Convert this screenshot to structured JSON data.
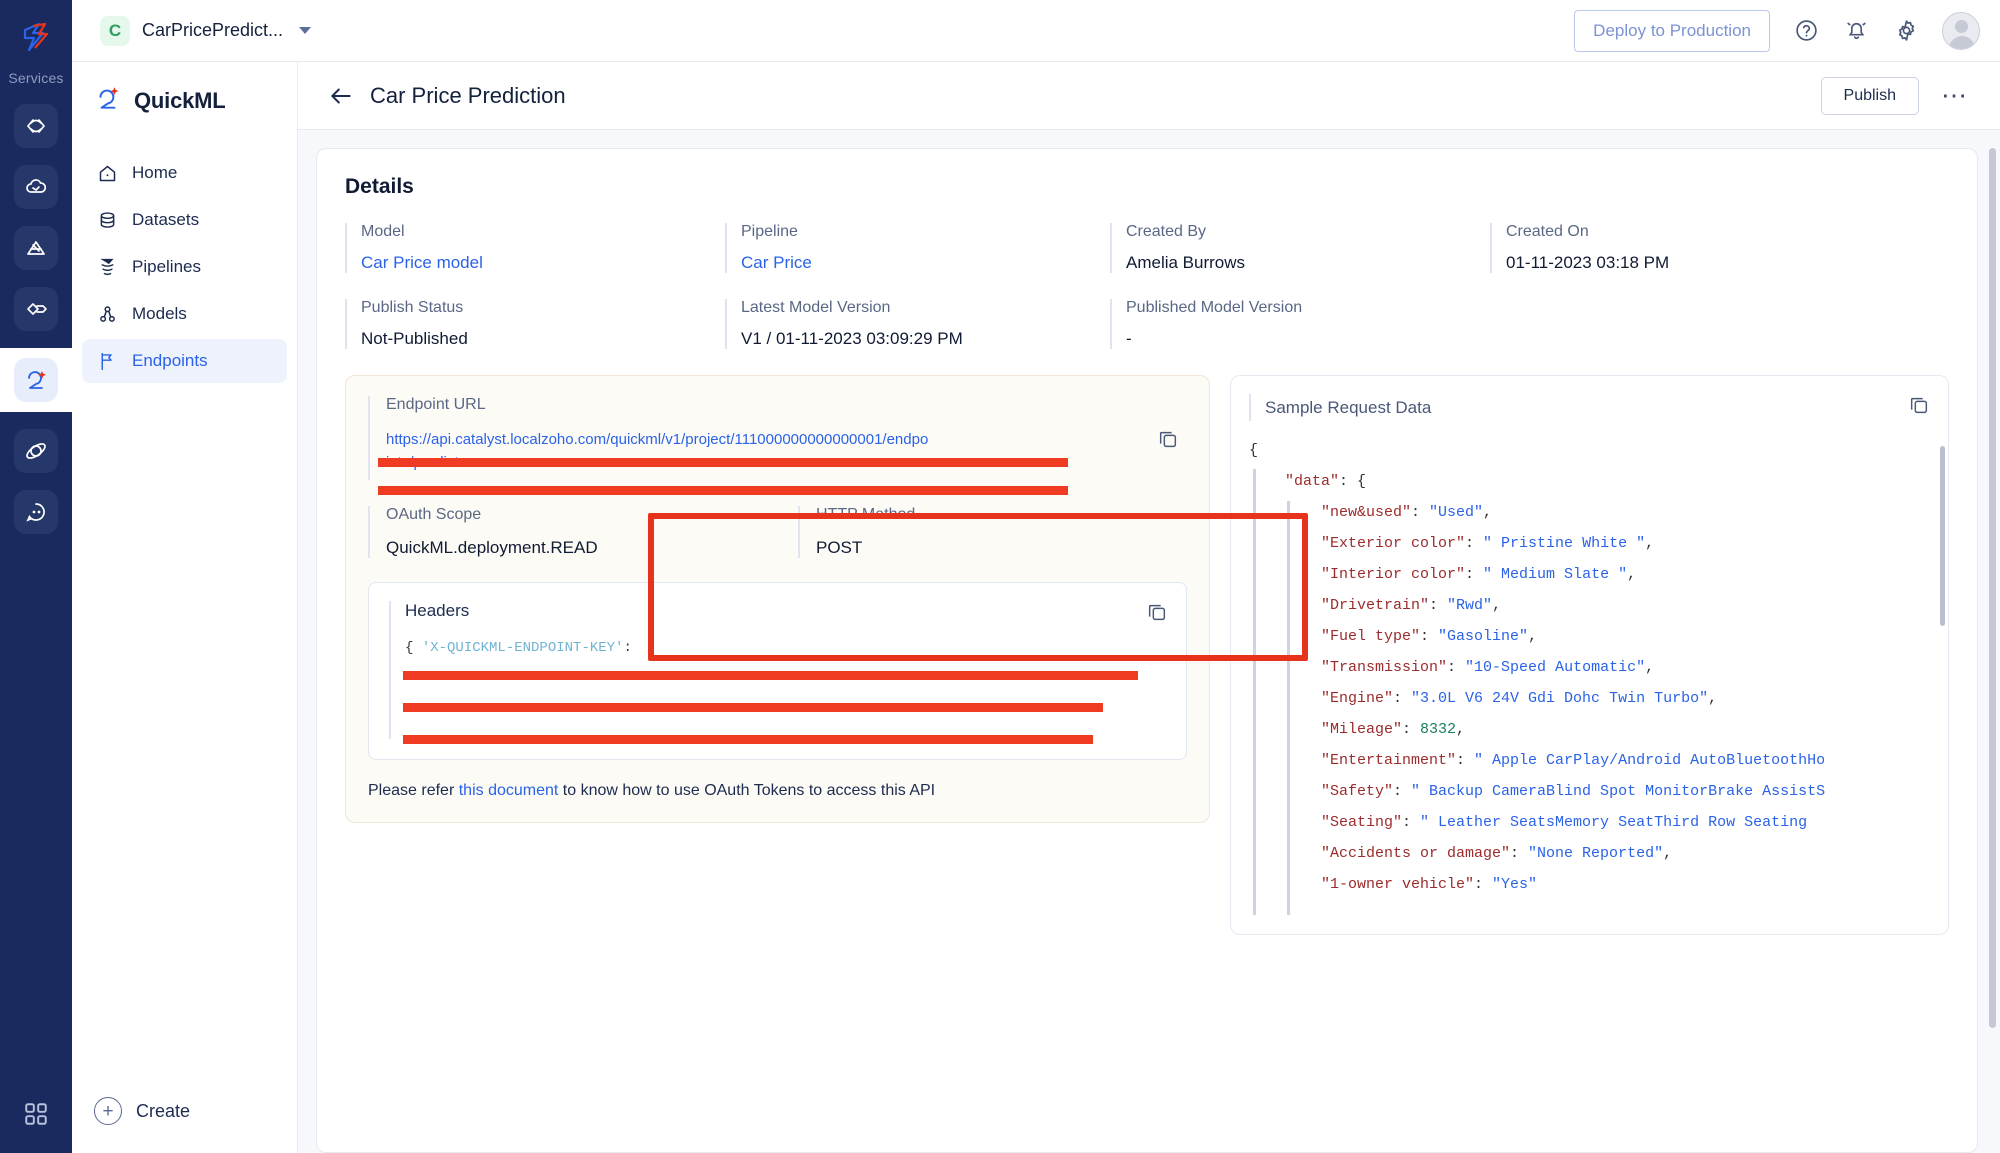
{
  "rail": {
    "services_label": "Services",
    "logo_icon": "brand-logo-icon",
    "items": [
      {
        "icon": "code-service-icon",
        "active": false
      },
      {
        "icon": "cloud-service-icon",
        "active": false
      },
      {
        "icon": "analytics-service-icon",
        "active": false
      },
      {
        "icon": "link-service-icon",
        "active": false
      },
      {
        "icon": "quickml-service-icon",
        "active": true
      },
      {
        "icon": "orbit-service-icon",
        "active": false
      },
      {
        "icon": "chat-service-icon",
        "active": false
      }
    ],
    "bottom_icon": "apps-grid-icon"
  },
  "topbar": {
    "project_initial": "C",
    "project_name": "CarPricePredict...",
    "dropdown_icon": "chevron-down-icon",
    "deploy_label": "Deploy to Production",
    "help_icon": "help-circle-icon",
    "bell_icon": "notification-bell-icon",
    "gear_icon": "settings-gear-icon",
    "avatar_icon": "user-avatar"
  },
  "sidebar": {
    "brand": "QuickML",
    "brand_icon": "quickml-logo-icon",
    "items": [
      {
        "label": "Home",
        "icon": "home-icon",
        "active": false
      },
      {
        "label": "Datasets",
        "icon": "database-icon",
        "active": false
      },
      {
        "label": "Pipelines",
        "icon": "funnel-icon",
        "active": false
      },
      {
        "label": "Models",
        "icon": "models-nodes-icon",
        "active": false
      },
      {
        "label": "Endpoints",
        "icon": "flag-icon",
        "active": true
      }
    ],
    "create_label": "Create",
    "create_icon": "plus-circle-icon"
  },
  "page": {
    "back_icon": "arrow-left-icon",
    "title": "Car Price Prediction",
    "publish_label": "Publish",
    "more_icon": "ellipsis-icon"
  },
  "details": {
    "heading": "Details",
    "row1": [
      {
        "label": "Model",
        "value": "Car Price model",
        "link": true
      },
      {
        "label": "Pipeline",
        "value": "Car Price",
        "link": true
      },
      {
        "label": "Created By",
        "value": "Amelia Burrows",
        "link": false
      },
      {
        "label": "Created On",
        "value": "01-11-2023 03:18 PM",
        "link": false
      }
    ],
    "row2": [
      {
        "label": "Publish Status",
        "value": "Not-Published",
        "link": false
      },
      {
        "label": "Latest Model Version",
        "value": "V1 / 01-11-2023 03:09:29 PM",
        "link": false
      },
      {
        "label": "Published Model Version",
        "value": "-",
        "link": false
      }
    ]
  },
  "endpoint": {
    "url_label": "Endpoint URL",
    "url_value": "https://api.catalyst.localzoho.com/quickml/v1/project/111000000000000001/endpoints/predict",
    "copy_icon": "copy-icon",
    "oauth_label": "OAuth Scope",
    "oauth_value": "QuickML.deployment.READ",
    "method_label": "HTTP Method",
    "method_value": "POST"
  },
  "headers": {
    "title": "Headers",
    "copy_icon": "copy-icon",
    "open_brace": "{",
    "key_name": "'X-QUICKML-ENDPOINT-KEY'",
    "colon": ":",
    "redacted_line1": "",
    "redacted_line2": "",
    "redacted_line3": ""
  },
  "footer": {
    "prefix": "Please refer ",
    "link": "this document",
    "suffix": " to know how to use OAuth Tokens to access this API"
  },
  "sample": {
    "title": "Sample Request Data",
    "copy_icon": "copy-icon",
    "lines": [
      {
        "indent": 0,
        "parts": [
          {
            "t": "{",
            "c": "jp"
          }
        ]
      },
      {
        "indent": 1,
        "parts": [
          {
            "t": "\"data\"",
            "c": "jk"
          },
          {
            "t": ": {",
            "c": "jp"
          }
        ]
      },
      {
        "indent": 2,
        "parts": [
          {
            "t": "\"new&used\"",
            "c": "jk"
          },
          {
            "t": ": ",
            "c": "jp"
          },
          {
            "t": "\"Used\"",
            "c": "jv"
          },
          {
            "t": ",",
            "c": "jp"
          }
        ]
      },
      {
        "indent": 2,
        "parts": [
          {
            "t": "\"Exterior color\"",
            "c": "jk"
          },
          {
            "t": ": ",
            "c": "jp"
          },
          {
            "t": "\" Pristine White \"",
            "c": "jv"
          },
          {
            "t": ",",
            "c": "jp"
          }
        ]
      },
      {
        "indent": 2,
        "parts": [
          {
            "t": "\"Interior color\"",
            "c": "jk"
          },
          {
            "t": ": ",
            "c": "jp"
          },
          {
            "t": "\" Medium Slate \"",
            "c": "jv"
          },
          {
            "t": ",",
            "c": "jp"
          }
        ]
      },
      {
        "indent": 2,
        "parts": [
          {
            "t": "\"Drivetrain\"",
            "c": "jk"
          },
          {
            "t": ": ",
            "c": "jp"
          },
          {
            "t": "\"Rwd\"",
            "c": "jv"
          },
          {
            "t": ",",
            "c": "jp"
          }
        ]
      },
      {
        "indent": 2,
        "parts": [
          {
            "t": "\"Fuel type\"",
            "c": "jk"
          },
          {
            "t": ": ",
            "c": "jp"
          },
          {
            "t": "\"Gasoline\"",
            "c": "jv"
          },
          {
            "t": ",",
            "c": "jp"
          }
        ]
      },
      {
        "indent": 2,
        "parts": [
          {
            "t": "\"Transmission\"",
            "c": "jk"
          },
          {
            "t": ": ",
            "c": "jp"
          },
          {
            "t": "\"10-Speed Automatic\"",
            "c": "jv"
          },
          {
            "t": ",",
            "c": "jp"
          }
        ]
      },
      {
        "indent": 2,
        "parts": [
          {
            "t": "\"Engine\"",
            "c": "jk"
          },
          {
            "t": ": ",
            "c": "jp"
          },
          {
            "t": "\"3.0L V6 24V Gdi Dohc Twin Turbo\"",
            "c": "jv"
          },
          {
            "t": ",",
            "c": "jp"
          }
        ]
      },
      {
        "indent": 2,
        "parts": [
          {
            "t": "\"Mileage\"",
            "c": "jk"
          },
          {
            "t": ": ",
            "c": "jp"
          },
          {
            "t": "8332",
            "c": "jn"
          },
          {
            "t": ",",
            "c": "jp"
          }
        ]
      },
      {
        "indent": 2,
        "parts": [
          {
            "t": "\"Entertainment\"",
            "c": "jk"
          },
          {
            "t": ": ",
            "c": "jp"
          },
          {
            "t": "\"  Apple CarPlay/Android AutoBluetoothHo",
            "c": "jv"
          }
        ]
      },
      {
        "indent": 2,
        "parts": [
          {
            "t": "\"Safety\"",
            "c": "jk"
          },
          {
            "t": ": ",
            "c": "jp"
          },
          {
            "t": "\"  Backup CameraBlind Spot MonitorBrake AssistS",
            "c": "jv"
          }
        ]
      },
      {
        "indent": 2,
        "parts": [
          {
            "t": "\"Seating\"",
            "c": "jk"
          },
          {
            "t": ": ",
            "c": "jp"
          },
          {
            "t": "\"  Leather SeatsMemory SeatThird Row Seating",
            "c": "jv"
          }
        ]
      },
      {
        "indent": 2,
        "parts": [
          {
            "t": "\"Accidents or damage\"",
            "c": "jk"
          },
          {
            "t": ": ",
            "c": "jp"
          },
          {
            "t": "\"None Reported\"",
            "c": "jv"
          },
          {
            "t": ",",
            "c": "jp"
          }
        ]
      },
      {
        "indent": 2,
        "parts": [
          {
            "t": "\"1-owner vehicle\"",
            "c": "jk"
          },
          {
            "t": ": ",
            "c": "jp"
          },
          {
            "t": "\"Yes\"",
            "c": "jv"
          }
        ]
      }
    ]
  },
  "colors": {
    "rail_bg": "#1b2a5e",
    "accent_blue": "#2a62e8",
    "redaction": "#ee3b22",
    "beige_bg": "#fdfbf5"
  }
}
